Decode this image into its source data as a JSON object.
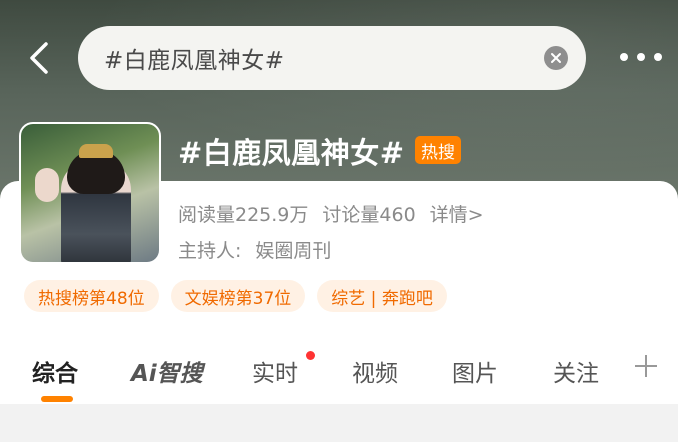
{
  "header": {
    "search_text": "#白鹿凤凰神女#"
  },
  "topic": {
    "title": "#白鹿凤凰神女#",
    "hot_badge": "热搜",
    "reads": "阅读量225.9万",
    "discussions": "讨论量460",
    "details_link": "详情>",
    "host_label": "主持人:",
    "host_name": "娱圈周刊"
  },
  "tags": [
    {
      "label": "热搜榜第48位"
    },
    {
      "label": "文娱榜第37位"
    },
    {
      "label": "综艺 | 奔跑吧"
    }
  ],
  "tabs": [
    {
      "label": "综合",
      "active": true
    },
    {
      "label": "Ai智搜"
    },
    {
      "label": "实时",
      "has_dot": true
    },
    {
      "label": "视频"
    },
    {
      "label": "图片"
    },
    {
      "label": "关注"
    }
  ],
  "colors": {
    "accent": "#ff8200",
    "tag_bg": "#fff1e4",
    "tag_text": "#f06a00",
    "notify_dot": "#ff3333"
  },
  "icons": {
    "back": "chevron-left-icon",
    "clear": "close-circle-icon",
    "more": "more-dots-icon",
    "add": "plus-icon"
  }
}
